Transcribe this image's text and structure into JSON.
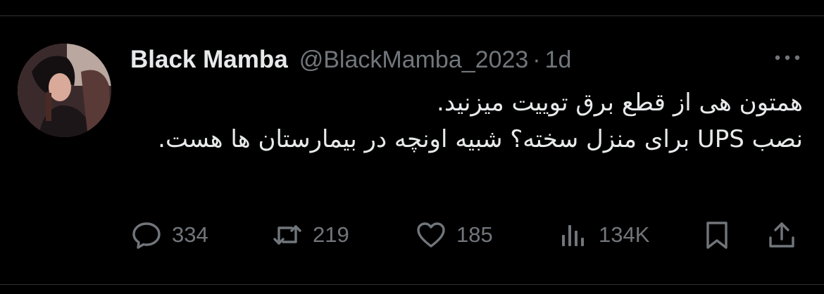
{
  "tweet": {
    "author": {
      "display_name": "Black Mamba",
      "handle": "@BlackMamba_2023",
      "avatar_icon": "profile-photo"
    },
    "separator": "·",
    "time": "1d",
    "text": "همتون هی از قطع برق توییت میزنید.\nنصب UPS برای منزل سخته؟ شبیه اونچه در بیمارستان ها هست."
  },
  "actions": {
    "reply_count": "334",
    "retweet_count": "219",
    "like_count": "185",
    "views_count": "134K"
  },
  "icons": {
    "more": "more-icon",
    "reply": "reply-icon",
    "retweet": "retweet-icon",
    "like": "heart-icon",
    "views": "views-icon",
    "bookmark": "bookmark-icon",
    "share": "share-icon"
  },
  "colors": {
    "background": "#000000",
    "text_primary": "#e7e9ea",
    "text_secondary": "#71767b",
    "divider": "#2f3336"
  }
}
